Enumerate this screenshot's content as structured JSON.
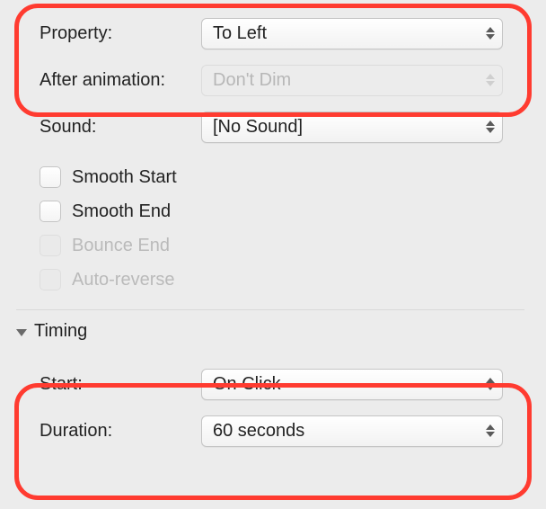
{
  "effect": {
    "property_label": "Property:",
    "property_value": "To Left",
    "after_animation_label": "After animation:",
    "after_animation_value": "Don't Dim",
    "sound_label": "Sound:",
    "sound_value": "[No Sound]",
    "checkboxes": {
      "smooth_start": "Smooth Start",
      "smooth_end": "Smooth End",
      "bounce_end": "Bounce End",
      "auto_reverse": "Auto-reverse"
    }
  },
  "timing": {
    "section_title": "Timing",
    "start_label": "Start:",
    "start_value": "On Click",
    "duration_label": "Duration:",
    "duration_value": "60 seconds"
  }
}
